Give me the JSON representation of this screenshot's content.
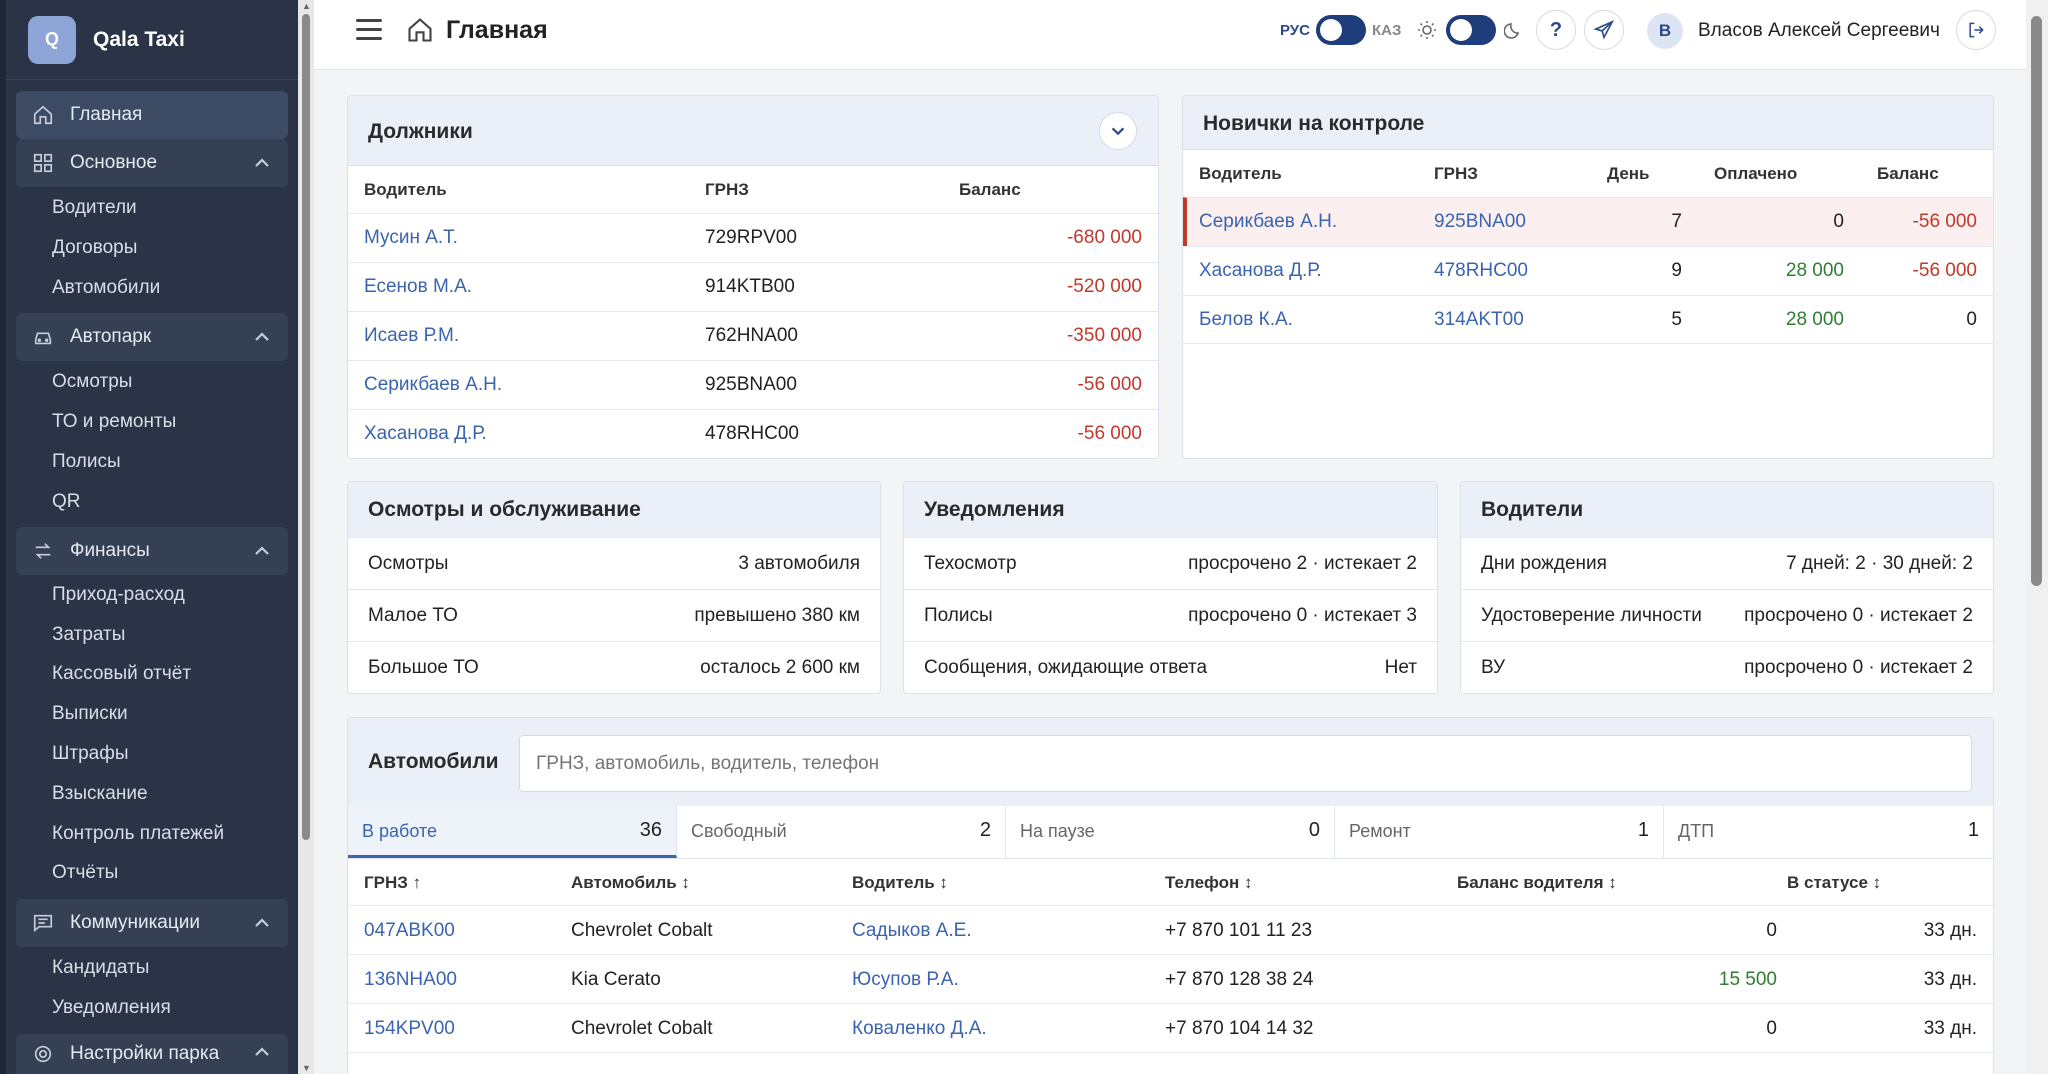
{
  "brand": {
    "logo_letter": "Q",
    "name": "Qala Taxi"
  },
  "sidebar": {
    "home": "Главная",
    "groups": [
      {
        "label": "Основное",
        "items": [
          "Водители",
          "Договоры",
          "Автомобили"
        ]
      },
      {
        "label": "Автопарк",
        "items": [
          "Осмотры",
          "ТО и ремонты",
          "Полисы",
          "QR"
        ]
      },
      {
        "label": "Финансы",
        "items": [
          "Приход-расход",
          "Затраты",
          "Кассовый отчёт",
          "Выписки",
          "Штрафы",
          "Взыскание",
          "Контроль платежей",
          "Отчёты"
        ]
      },
      {
        "label": "Коммуникации",
        "items": [
          "Кандидаты",
          "Уведомления"
        ]
      },
      {
        "label": "Настройки парка",
        "items": []
      }
    ]
  },
  "header": {
    "title": "Главная",
    "lang_left": "РУС",
    "lang_right": "КАЗ",
    "help": "?",
    "avatar_letter": "В",
    "user_name": "Власов Алексей Сергеевич"
  },
  "debtors": {
    "title": "Должники",
    "columns": [
      "Водитель",
      "ГРНЗ",
      "Баланс"
    ],
    "rows": [
      {
        "driver": "Мусин А.Т.",
        "plate": "729RPV00",
        "balance": "-680 000"
      },
      {
        "driver": "Есенов М.А.",
        "plate": "914KTB00",
        "balance": "-520 000"
      },
      {
        "driver": "Исаев Р.М.",
        "plate": "762HNA00",
        "balance": "-350 000"
      },
      {
        "driver": "Серикбаев А.Н.",
        "plate": "925BNA00",
        "balance": "-56 000"
      },
      {
        "driver": "Хасанова Д.Р.",
        "plate": "478RHC00",
        "balance": "-56 000"
      }
    ]
  },
  "newcomers": {
    "title": "Новички на контроле",
    "columns": [
      "Водитель",
      "ГРНЗ",
      "День",
      "Оплачено",
      "Баланс"
    ],
    "rows": [
      {
        "driver": "Серикбаев А.Н.",
        "plate": "925BNA00",
        "day": "7",
        "paid": "0",
        "balance": "-56 000"
      },
      {
        "driver": "Хасанова Д.Р.",
        "plate": "478RHC00",
        "day": "9",
        "paid": "28 000",
        "balance": "-56 000"
      },
      {
        "driver": "Белов К.А.",
        "plate": "314AKT00",
        "day": "5",
        "paid": "28 000",
        "balance": "0"
      }
    ]
  },
  "inspections": {
    "title": "Осмотры и обслуживание",
    "rows": [
      {
        "label": "Осмотры",
        "value": "3 автомобиля"
      },
      {
        "label": "Малое ТО",
        "value": "превышено 380 км"
      },
      {
        "label": "Большое ТО",
        "value": "осталось 2 600 км"
      }
    ]
  },
  "notifications": {
    "title": "Уведомления",
    "rows": [
      {
        "label": "Техосмотр",
        "value": "просрочено 2 · истекает 2"
      },
      {
        "label": "Полисы",
        "value": "просрочено 0 · истекает 3"
      },
      {
        "label": "Сообщения, ожидающие ответа",
        "value": "Нет"
      }
    ]
  },
  "drivers_card": {
    "title": "Водители",
    "rows": [
      {
        "label": "Дни рождения",
        "value": "7 дней: 2 · 30 дней: 2"
      },
      {
        "label": "Удостоверение личности",
        "value": "просрочено 0 · истекает 2"
      },
      {
        "label": "ВУ",
        "value": "просрочено 0 · истекает 2"
      }
    ]
  },
  "cars": {
    "title": "Автомобили",
    "search_placeholder": "ГРНЗ, автомобиль, водитель, телефон",
    "tabs": [
      {
        "label": "В работе",
        "count": "36"
      },
      {
        "label": "Свободный",
        "count": "2"
      },
      {
        "label": "На паузе",
        "count": "0"
      },
      {
        "label": "Ремонт",
        "count": "1"
      },
      {
        "label": "ДТП",
        "count": "1"
      }
    ],
    "columns": [
      "ГРНЗ ↑",
      "Автомобиль ↕",
      "Водитель ↕",
      "Телефон ↕",
      "Баланс водителя ↕",
      "В статусе ↕"
    ],
    "rows": [
      {
        "plate": "047ABK00",
        "car": "Chevrolet Cobalt",
        "driver": "Садыков А.Е.",
        "phone": "+7 870 101 11 23",
        "balance": "0",
        "status": "33 дн."
      },
      {
        "plate": "136NHA00",
        "car": "Kia Cerato",
        "driver": "Юсупов Р.А.",
        "phone": "+7 870 128 38 24",
        "balance": "15 500",
        "status": "33 дн."
      },
      {
        "plate": "154KPV00",
        "car": "Chevrolet Cobalt",
        "driver": "Коваленко Д.А.",
        "phone": "+7 870 104 14 32",
        "balance": "0",
        "status": "33 дн."
      }
    ]
  }
}
